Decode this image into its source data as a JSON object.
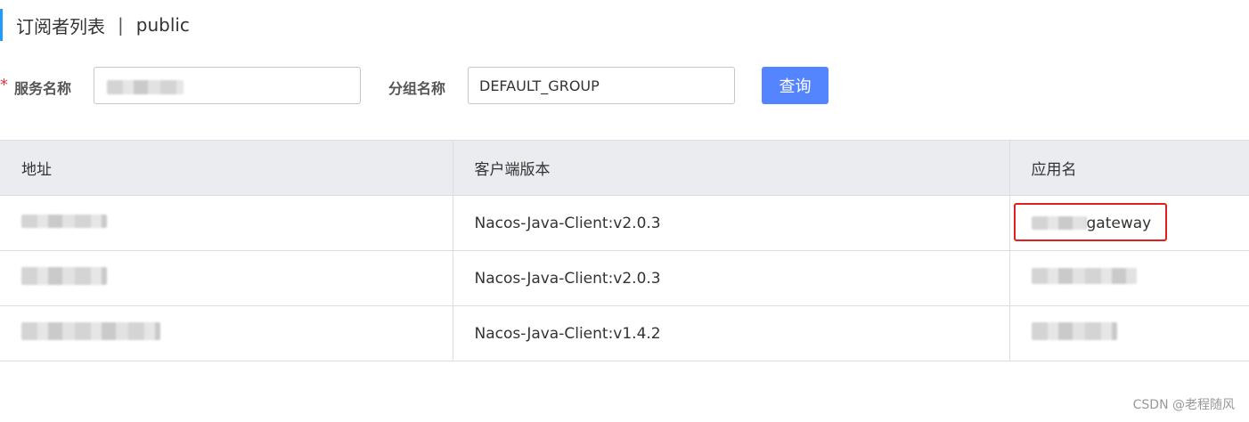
{
  "header": {
    "title": "订阅者列表",
    "separator": "|",
    "namespace": "public"
  },
  "form": {
    "required_mark": "*",
    "service_name_label": "服务名称",
    "service_name_value": "",
    "group_name_label": "分组名称",
    "group_name_value": "DEFAULT_GROUP",
    "query_button_label": "查询"
  },
  "table": {
    "columns": [
      "地址",
      "客户端版本",
      "应用名"
    ],
    "rows": [
      {
        "address": "",
        "client_version": "Nacos-Java-Client:v2.0.3",
        "app_name": "gateway"
      },
      {
        "address": "",
        "client_version": "Nacos-Java-Client:v2.0.3",
        "app_name": ""
      },
      {
        "address": "",
        "client_version": "Nacos-Java-Client:v1.4.2",
        "app_name": ""
      }
    ]
  },
  "watermark": "CSDN @老程随风",
  "colors": {
    "accent": "#209bfa",
    "primary_button": "#5584ff",
    "required": "#e4393c",
    "highlight": "#e02020",
    "table_header_bg": "#ebecf0"
  }
}
